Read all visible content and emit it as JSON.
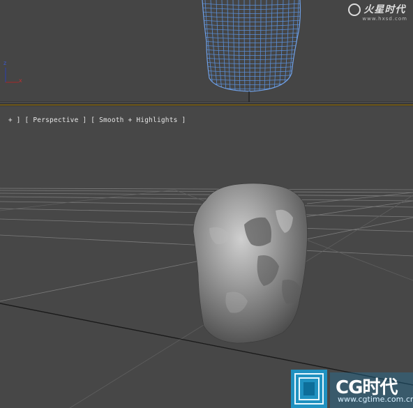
{
  "top_viewport": {
    "axis_labels": {
      "z": "z",
      "x": "x"
    }
  },
  "perspective_viewport": {
    "label_parts": [
      "+ ]",
      "[ Perspective ]",
      "[ Smooth + Highlights ]"
    ]
  },
  "watermarks": {
    "top_brand": "火星时代",
    "top_site": "www.hxsd.com",
    "bottom_brand": "CG时代",
    "bottom_site": "www.cgtime.com.cn"
  },
  "colors": {
    "viewport_bg": "#474747",
    "wireframe": "#5a8fd8",
    "active_border": "#b48a12",
    "grid": "#7a7a7a",
    "logo_blue": "#1a9fd6"
  }
}
